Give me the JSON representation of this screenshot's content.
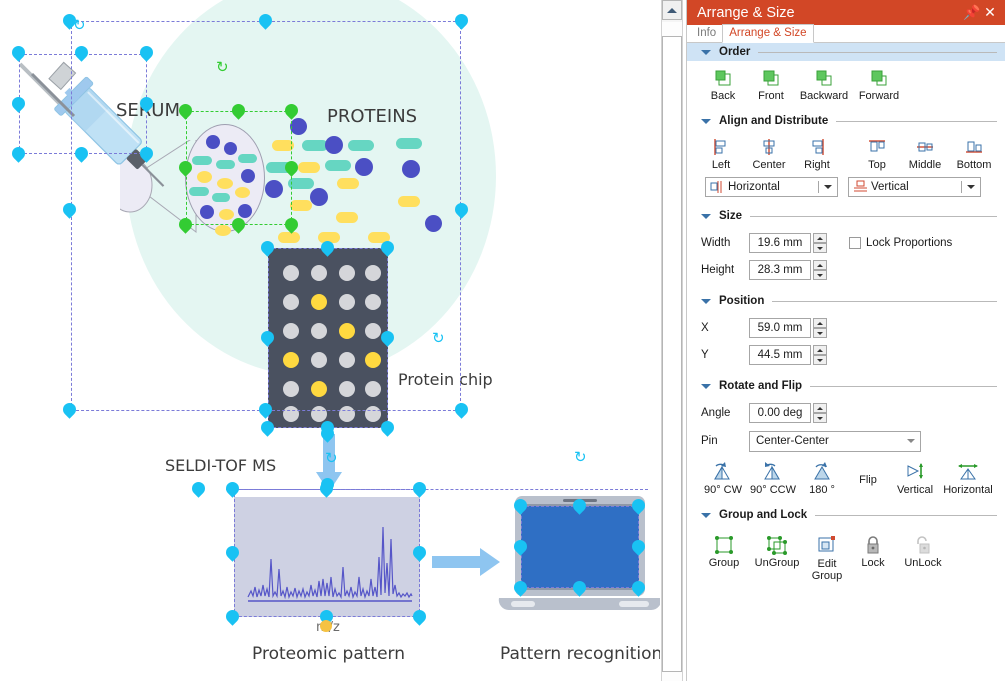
{
  "panel": {
    "title": "Arrange & Size",
    "pin_icon": "pin-icon",
    "close_icon": "close-icon",
    "tabs": [
      {
        "label": "Info",
        "selected": false
      },
      {
        "label": "Arrange & Size",
        "selected": true
      }
    ],
    "sections": [
      {
        "id": "order",
        "label": "Order",
        "highlighted": true
      },
      {
        "id": "align",
        "label": "Align and Distribute",
        "highlighted": false
      },
      {
        "id": "size",
        "label": "Size",
        "highlighted": false
      },
      {
        "id": "position",
        "label": "Position",
        "highlighted": false
      },
      {
        "id": "rotate",
        "label": "Rotate and Flip",
        "highlighted": false
      },
      {
        "id": "group",
        "label": "Group and Lock",
        "highlighted": false
      }
    ],
    "order": {
      "buttons": [
        {
          "label": "Back",
          "icon": "send-to-back-icon"
        },
        {
          "label": "Front",
          "icon": "bring-to-front-icon"
        },
        {
          "label": "Backward",
          "icon": "send-backward-icon"
        },
        {
          "label": "Forward",
          "icon": "bring-forward-icon"
        }
      ]
    },
    "align": {
      "buttons": [
        {
          "label": "Left",
          "icon": "align-left-icon"
        },
        {
          "label": "Center",
          "icon": "align-center-icon"
        },
        {
          "label": "Right",
          "icon": "align-right-icon"
        },
        {
          "label": "Top",
          "icon": "align-top-icon"
        },
        {
          "label": "Middle",
          "icon": "align-middle-icon"
        },
        {
          "label": "Bottom",
          "icon": "align-bottom-icon"
        }
      ],
      "distribute_horizontal": {
        "value": "Horizontal",
        "icon": "distribute-horizontal-icon"
      },
      "distribute_vertical": {
        "value": "Vertical",
        "icon": "distribute-vertical-icon"
      }
    },
    "size": {
      "width_label": "Width",
      "width_value": "19.6 mm",
      "height_label": "Height",
      "height_value": "28.3 mm",
      "lock_proportions_label": "Lock Proportions",
      "lock_proportions_checked": false
    },
    "position": {
      "x_label": "X",
      "x_value": "59.0 mm",
      "y_label": "Y",
      "y_value": "44.5 mm"
    },
    "rotate": {
      "angle_label": "Angle",
      "angle_value": "0.00 deg",
      "pin_label": "Pin",
      "pin_value": "Center-Center",
      "buttons": [
        {
          "label": "90° CW",
          "icon": "rotate-cw-icon"
        },
        {
          "label": "90° CCW",
          "icon": "rotate-ccw-icon"
        },
        {
          "label": "180 °",
          "icon": "rotate-180-icon"
        }
      ],
      "flip_label": "Flip",
      "flip_buttons": [
        {
          "label": "Vertical",
          "icon": "flip-vertical-icon"
        },
        {
          "label": "Horizontal",
          "icon": "flip-horizontal-icon"
        }
      ]
    },
    "group": {
      "buttons": [
        {
          "label": "Group",
          "icon": "group-icon"
        },
        {
          "label": "UnGroup",
          "icon": "ungroup-icon"
        },
        {
          "label": "Edit\nGroup",
          "icon": "edit-group-icon"
        },
        {
          "label": "Lock",
          "icon": "lock-icon"
        },
        {
          "label": "UnLock",
          "icon": "unlock-icon"
        }
      ]
    }
  },
  "canvas": {
    "labels": {
      "serum": "SERUM",
      "proteins": "PROTEINS",
      "protein_chip": "Protein chip",
      "seldi": "SELDI-TOF MS",
      "mz": "m/z",
      "proteomic_pattern": "Proteomic pattern",
      "pattern_recognition": "Pattern recognition"
    },
    "colors": {
      "handle_blue": "#19c2f3",
      "handle_green": "#33cc33",
      "selection_dash": "#7b7bd8",
      "blob_teal": "#e4f6f2",
      "chip_body": "#4a5160",
      "chip_well": "#d5d6da",
      "chip_well_active": "#ffd940",
      "protein_purple": "#4b4fc4",
      "protein_teal": "#66d6c2",
      "protein_yellow": "#ffdf5e",
      "spectrum_bg": "#ced1e3",
      "spectrum_line": "#5656c8",
      "laptop_screen": "#2f6fc4",
      "arrow_blue": "#8ec5f0"
    },
    "chip_grid": {
      "cols": 4,
      "rows": 6,
      "active_wells": [
        [
          1,
          1
        ],
        [
          2,
          2
        ],
        [
          3,
          0
        ],
        [
          3,
          3
        ],
        [
          4,
          1
        ]
      ]
    },
    "scrollbar": {
      "orientation": "vertical",
      "position": "top"
    }
  }
}
